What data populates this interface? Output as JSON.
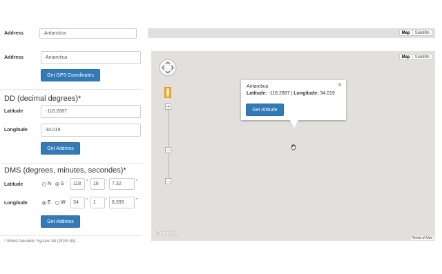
{
  "top_strip": {
    "address_label": "Address",
    "address_value": "Antarctica",
    "map_type": {
      "map": "Map",
      "satellite": "Satellite"
    }
  },
  "address": {
    "label": "Address",
    "value": "Antarctica",
    "button": "Get GPS Coordinates"
  },
  "dd": {
    "heading": "DD (decimal degrees)*",
    "latitude_label": "Latitude",
    "latitude_value": "-118.2687",
    "longitude_label": "Longitude",
    "longitude_value": "34.019",
    "button": "Get Address"
  },
  "dms": {
    "heading": "DMS (degrees, minutes, secondes)*",
    "latitude_label": "Latitude",
    "lat_n": "N",
    "lat_s": "S",
    "lat_selected": "S",
    "lat_deg": "118",
    "lat_min": "16",
    "lat_sec": "7.32",
    "longitude_label": "Longitude",
    "lon_e": "E",
    "lon_w": "W",
    "lon_selected": "E",
    "lon_deg": "34",
    "lon_min": "1",
    "lon_sec": "8.399",
    "button": "Get Address",
    "unit_deg": "°",
    "unit_min": "'",
    "unit_sec": "\""
  },
  "footnote": "* World Geodetic System 84 (WGS 84)",
  "map": {
    "map_type": {
      "map": "Map",
      "satellite": "Satellite"
    },
    "info_window": {
      "title": "Antarctica",
      "lat_label": "Latitude:",
      "lat_value": "-118.2687",
      "separator": "|",
      "lon_label": "Longitude:",
      "lon_value": "34.019",
      "button": "Get Altitude",
      "close": "×"
    },
    "zoom_in": "+",
    "zoom_out": "−",
    "zoom_out_bottom": "−",
    "logo": "Google",
    "terms": "Terms of Use"
  },
  "colors": {
    "accent": "#337ab7",
    "map_bg": "#e2e0dc",
    "pegman": "#f5a623"
  }
}
